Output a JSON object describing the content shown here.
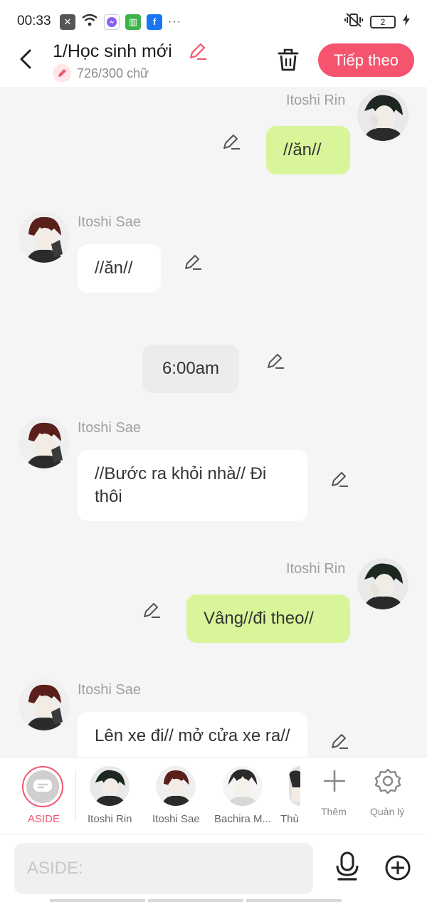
{
  "status": {
    "time": "00:33",
    "battery": "2",
    "icons": [
      "close-box-icon",
      "wifi-icon",
      "messenger-icon",
      "shop-icon",
      "facebook-icon",
      "more-icon"
    ],
    "more": "···"
  },
  "header": {
    "title": "1/Học sinh mới",
    "word_count": "726/300 chữ",
    "next_label": "Tiếp theo",
    "accent": "#f5546f"
  },
  "messages": [
    {
      "side": "right",
      "name": "Itoshi Rin",
      "text": "//ăn//"
    },
    {
      "side": "left",
      "name": "Itoshi Sae",
      "text": "//ăn//"
    },
    {
      "side": "system",
      "text": "6:00am"
    },
    {
      "side": "left",
      "name": "Itoshi Sae",
      "text": "//Bước ra khỏi nhà// Đi thôi"
    },
    {
      "side": "right",
      "name": "Itoshi Rin",
      "text": "Vâng//đi theo//"
    },
    {
      "side": "left",
      "name": "Itoshi Sae",
      "text": "Lên xe đi// mở cửa xe ra//"
    }
  ],
  "characters": [
    {
      "label": "ASIDE",
      "selected": true
    },
    {
      "label": "Itoshi Rin"
    },
    {
      "label": "Itoshi Sae"
    },
    {
      "label": "Bachira M..."
    },
    {
      "label": "Thù"
    }
  ],
  "tools": {
    "add_label": "Thêm",
    "manage_label": "Quản lý"
  },
  "input": {
    "placeholder": "ASIDE:"
  }
}
